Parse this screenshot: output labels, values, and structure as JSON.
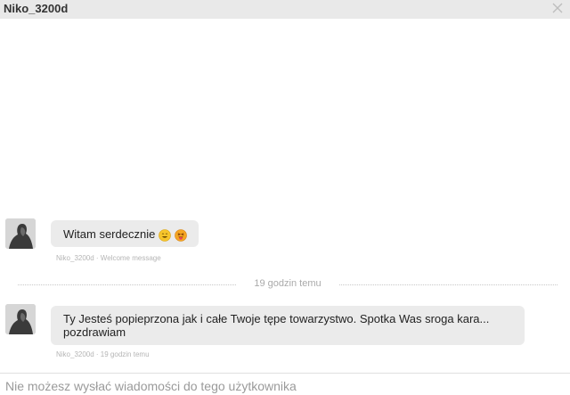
{
  "header": {
    "username": "Niko_3200d"
  },
  "messages": [
    {
      "text": "Witam serdecznie",
      "emoji": [
        "grinning-face-icon",
        "tongue-face-icon"
      ],
      "meta": "Niko_3200d · Welcome message"
    },
    {
      "text": "Ty Jesteś popieprzona jak i całe Twoje tępe towarzystwo. Spotka Was sroga kara... pozdrawiam",
      "meta": "Niko_3200d · 19 godzin temu"
    }
  ],
  "divider": {
    "label": "19 godzin temu"
  },
  "footer": {
    "notice": "Nie możesz wysłać wiadomości do tego użytkownika"
  }
}
